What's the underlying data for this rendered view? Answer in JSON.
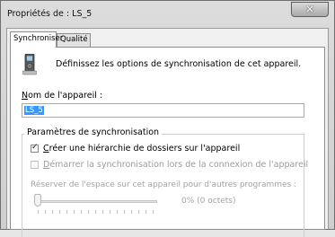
{
  "window": {
    "title": "Propriétés de : LS_5",
    "close_glyph": "✕"
  },
  "tabs": [
    {
      "label": "Synchroniser",
      "active": true
    },
    {
      "label": "Qualité",
      "active": false
    }
  ],
  "sync_tab": {
    "device_icon": "portable-media-player-icon",
    "header_text": "Définissez les options de synchronisation de cet appareil.",
    "device_name_label_prefix": "N",
    "device_name_label_rest": "om de l'appareil :",
    "device_name_value": "LS_5",
    "group_title": "Paramètres de synchronisation",
    "options": [
      {
        "prefix": "C",
        "rest": "réer une hiérarchie de dossiers sur l'appareil",
        "checked": true,
        "enabled": true
      },
      {
        "prefix": "D",
        "rest": "émarrer la synchronisation lors de la connexion de l'appareil",
        "checked": false,
        "enabled": false
      }
    ],
    "reserve_label": "Réserver de l'espace sur cet appareil pour d'autres programmes :",
    "reserve_value_text": "0% (0 octets)",
    "reserve_percent": 0
  },
  "colors": {
    "selection": "#3399ff",
    "disabled_text": "#9c9c9c"
  }
}
